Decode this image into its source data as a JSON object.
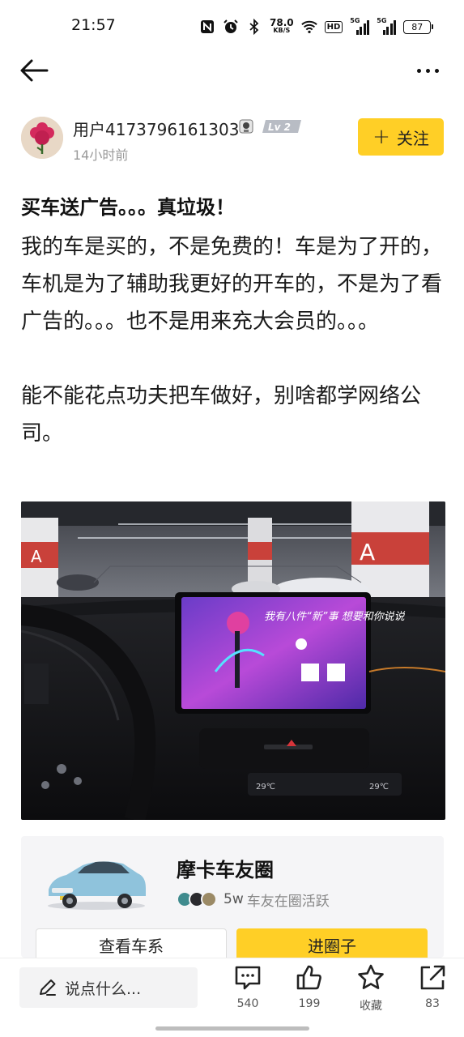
{
  "status_bar": {
    "time": "21:57",
    "net_speed_value": "78.0",
    "net_speed_unit": "KB/S",
    "hd_label": "HD",
    "signal1_label": "5G",
    "signal2_label": "5G",
    "battery": "87",
    "icons": [
      "nfc-icon",
      "alarm-icon",
      "bluetooth-icon",
      "wifi-icon",
      "hd-voice-icon",
      "signal-icon",
      "battery-icon"
    ]
  },
  "nav": {
    "back_icon": "arrow-left-icon",
    "more_icon": "more-dots-icon"
  },
  "author": {
    "username": "用户4173796161303",
    "level_badge": "Lv 2",
    "post_time": "14小时前",
    "follow_label": "关注",
    "follow_icon": "plus-icon"
  },
  "post": {
    "title": "买车送广告。。。真垃圾！",
    "paragraphs": [
      "我的车是买的，不是免费的！车是为了开的，车机是为了辅助我更好的开车的，不是为了看广告的。。。也不是用来充大会员的。。。",
      "能不能花点功夫把车做好，别啥都学网络公司。"
    ],
    "image_screen_text": "我有八件“新”事 想要和你说说"
  },
  "circle": {
    "name": "摩卡车友圈",
    "member_count": "5w",
    "member_text": "车友在圈活跃",
    "view_series_label": "查看车系",
    "join_label": "进圈子"
  },
  "bottom_bar": {
    "comment_placeholder": "说点什么...",
    "comment_icon": "pencil-icon",
    "actions": [
      {
        "icon": "comment-icon",
        "label": "540"
      },
      {
        "icon": "thumbs-up-icon",
        "label": "199"
      },
      {
        "icon": "star-icon",
        "label": "收藏"
      },
      {
        "icon": "share-icon",
        "label": "83"
      }
    ]
  },
  "colors": {
    "accent_yellow": "#ffcf26",
    "card_bg": "#f5f5f7",
    "muted_text": "#9a9a9a"
  }
}
